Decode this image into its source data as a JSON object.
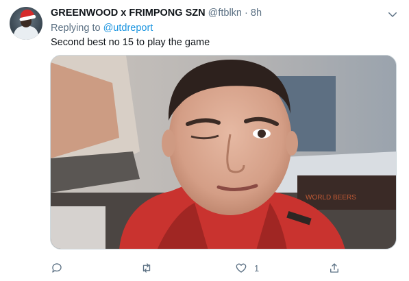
{
  "tweet": {
    "display_name": "GREENWOOD x FRIMPONG SZN",
    "handle": "@ftblkn",
    "separator": "·",
    "time": "8h",
    "replying_prefix": "Replying to",
    "replying_to": "@utdreport",
    "text": "Second best no 15 to play the game",
    "image_sign_text": "WORLD BEERS"
  },
  "actions": {
    "reply_icon": "speech-bubble-icon",
    "retweet_icon": "retweet-arrows-icon",
    "like_icon": "heart-icon",
    "like_count": "1",
    "share_icon": "share-upload-icon",
    "menu_icon": "chevron-down-icon"
  },
  "colors": {
    "link": "#1b95e0",
    "secondary_text": "#5b7083",
    "primary_text": "#0f1419",
    "border": "#cfd9de"
  }
}
